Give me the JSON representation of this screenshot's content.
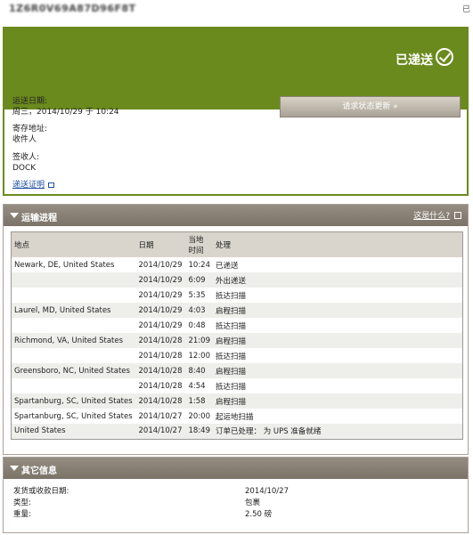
{
  "top": {
    "tracking_number": "1Z6R0V69A87D96F8T",
    "right_text": "已"
  },
  "status": {
    "label": "已递送",
    "delivery_date_label": "运送日期:",
    "delivery_date_value": "周三，2014/10/29 于 10:24",
    "left_at_label": "寄存地址:",
    "left_at_value": "收件人",
    "signed_by_label": "签收人:",
    "signed_by_value": "DOCK",
    "proof_link": "递送证明",
    "update_button": "请求状态更新 »"
  },
  "progress": {
    "title": "运输进程",
    "whats_this": "这是什么?",
    "headers": [
      "地点",
      "日期",
      "当地时间",
      "处理"
    ],
    "rows": [
      {
        "location": "Newark, DE, United States",
        "date": "2014/10/29",
        "time": "10:24",
        "activity": "已递送"
      },
      {
        "location": "",
        "date": "2014/10/29",
        "time": "6:09",
        "activity": "外出递送"
      },
      {
        "location": "",
        "date": "2014/10/29",
        "time": "5:35",
        "activity": "抵达扫描"
      },
      {
        "location": "Laurel, MD, United States",
        "date": "2014/10/29",
        "time": "4:03",
        "activity": "启程扫描"
      },
      {
        "location": "",
        "date": "2014/10/29",
        "time": "0:48",
        "activity": "抵达扫描"
      },
      {
        "location": "Richmond, VA, United States",
        "date": "2014/10/28",
        "time": "21:09",
        "activity": "启程扫描"
      },
      {
        "location": "",
        "date": "2014/10/28",
        "time": "12:00",
        "activity": "抵达扫描"
      },
      {
        "location": "Greensboro, NC, United States",
        "date": "2014/10/28",
        "time": "8:40",
        "activity": "启程扫描"
      },
      {
        "location": "",
        "date": "2014/10/28",
        "time": "4:54",
        "activity": "抵达扫描"
      },
      {
        "location": "Spartanburg, SC, United States",
        "date": "2014/10/28",
        "time": "1:58",
        "activity": "启程扫描"
      },
      {
        "location": "Spartanburg, SC, United States",
        "date": "2014/10/27",
        "time": "20:00",
        "activity": "起运地扫描"
      },
      {
        "location": "United States",
        "date": "2014/10/27",
        "time": "18:49",
        "activity": "订单已处理： 为 UPS 准备就绪"
      }
    ]
  },
  "other": {
    "title": "其它信息",
    "items": [
      {
        "label": "发货或收款日期:",
        "value": "2014/10/27"
      },
      {
        "label": "类型:",
        "value": "包裹"
      },
      {
        "label": "重量:",
        "value": "2.50 磅"
      }
    ]
  },
  "colors": {
    "status_green": "#6b8a1e",
    "section_brown": "#8a8177",
    "link_blue": "#1e50a0"
  }
}
